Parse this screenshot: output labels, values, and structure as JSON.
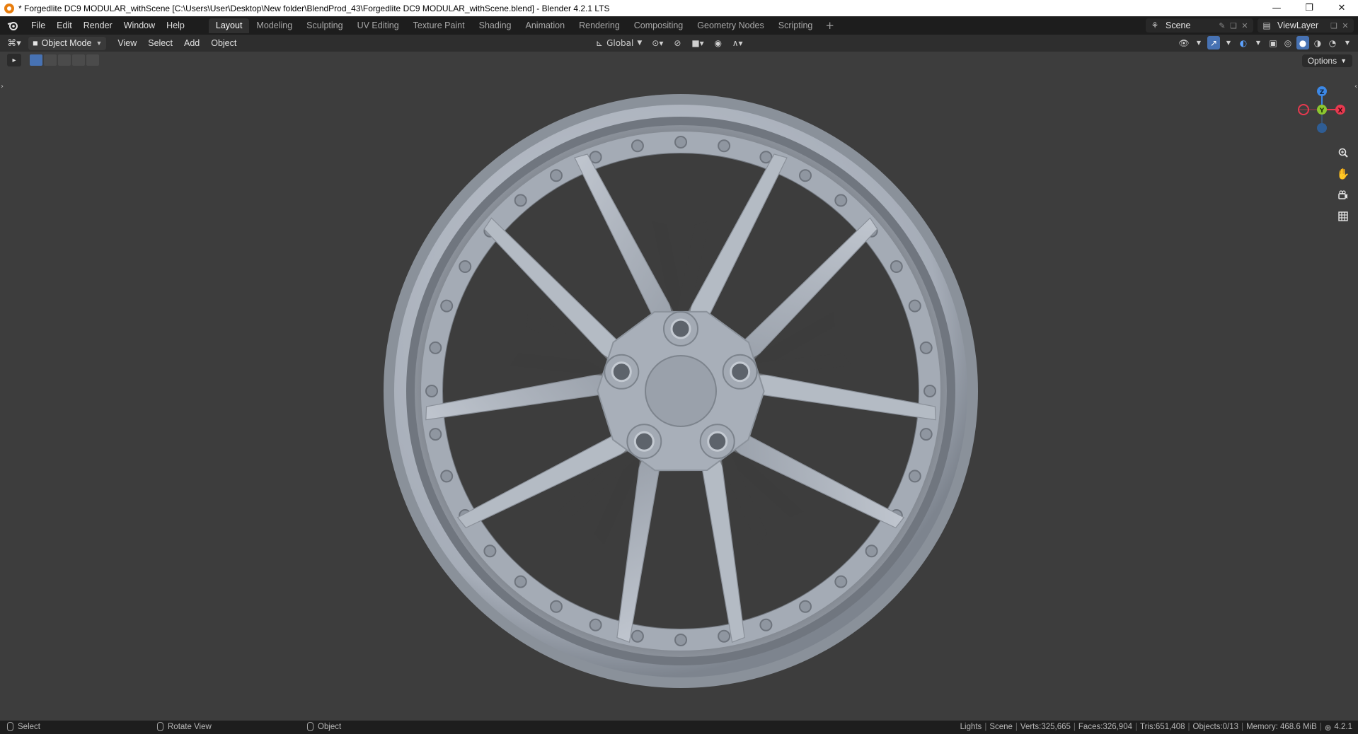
{
  "window": {
    "title": "* Forgedlite DC9 MODULAR_withScene [C:\\Users\\User\\Desktop\\New folder\\BlendProd_43\\Forgedlite DC9 MODULAR_withScene.blend] - Blender 4.2.1 LTS",
    "minimize": "—",
    "restore": "❐",
    "close": "✕"
  },
  "menu": {
    "items": [
      "File",
      "Edit",
      "Render",
      "Window",
      "Help"
    ]
  },
  "workspaces": {
    "tabs": [
      "Layout",
      "Modeling",
      "Sculpting",
      "UV Editing",
      "Texture Paint",
      "Shading",
      "Animation",
      "Rendering",
      "Compositing",
      "Geometry Nodes",
      "Scripting"
    ],
    "active": "Layout",
    "add": "+"
  },
  "scene": {
    "scene_name": "Scene",
    "view_layer": "ViewLayer"
  },
  "viewport_header": {
    "mode": "Object Mode",
    "menus": [
      "View",
      "Select",
      "Add",
      "Object"
    ],
    "transform_orientation": "Global",
    "options_label": "Options"
  },
  "gizmo": {
    "z": "Z",
    "y": "Y",
    "x": "X",
    "colors": {
      "x": "#e8394f",
      "y": "#8cc62f",
      "z": "#3c88e6"
    }
  },
  "statusbar": {
    "select": "Select",
    "rotate_view": "Rotate View",
    "object": "Object",
    "stats": [
      "Lights",
      "Scene",
      "Verts:325,665",
      "Faces:326,904",
      "Tris:651,408",
      "Objects:0/13",
      "Memory: 468.6 MiB"
    ],
    "version": "4.2.1"
  },
  "colors": {
    "viewport_bg": "#3d3d3d",
    "active_tab": "#303030",
    "accent": "#4772b3"
  }
}
